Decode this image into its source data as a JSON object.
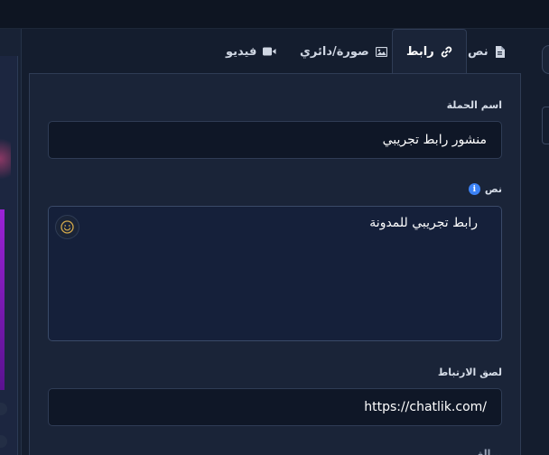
{
  "tabs": [
    {
      "label": "نص",
      "icon": "document-icon",
      "active": false
    },
    {
      "label": "رابط",
      "icon": "link-icon",
      "active": true
    },
    {
      "label": "صورة/دائري",
      "icon": "image-icon",
      "active": false
    },
    {
      "label": "فيديو",
      "icon": "video-camera-icon",
      "active": false
    }
  ],
  "form": {
    "campaign_name_label": "اسم الحملة",
    "campaign_name_value": "منشور رابط تجريبي",
    "text_label": "نص",
    "text_info_icon": "i",
    "text_value": "رابط تجريبي للمدونة",
    "emoji_icon": "smiley-face-icon",
    "link_label": "لصق الارتباط",
    "link_value": "https://chatlik.com/",
    "next_label_partial": "...الق"
  },
  "colors": {
    "background": "#141d2e",
    "panel": "#1a2438",
    "input": "#0f1727",
    "border": "#2f3c55",
    "info_blue": "#3b82f6",
    "accent_purple": "#9b22d6"
  }
}
